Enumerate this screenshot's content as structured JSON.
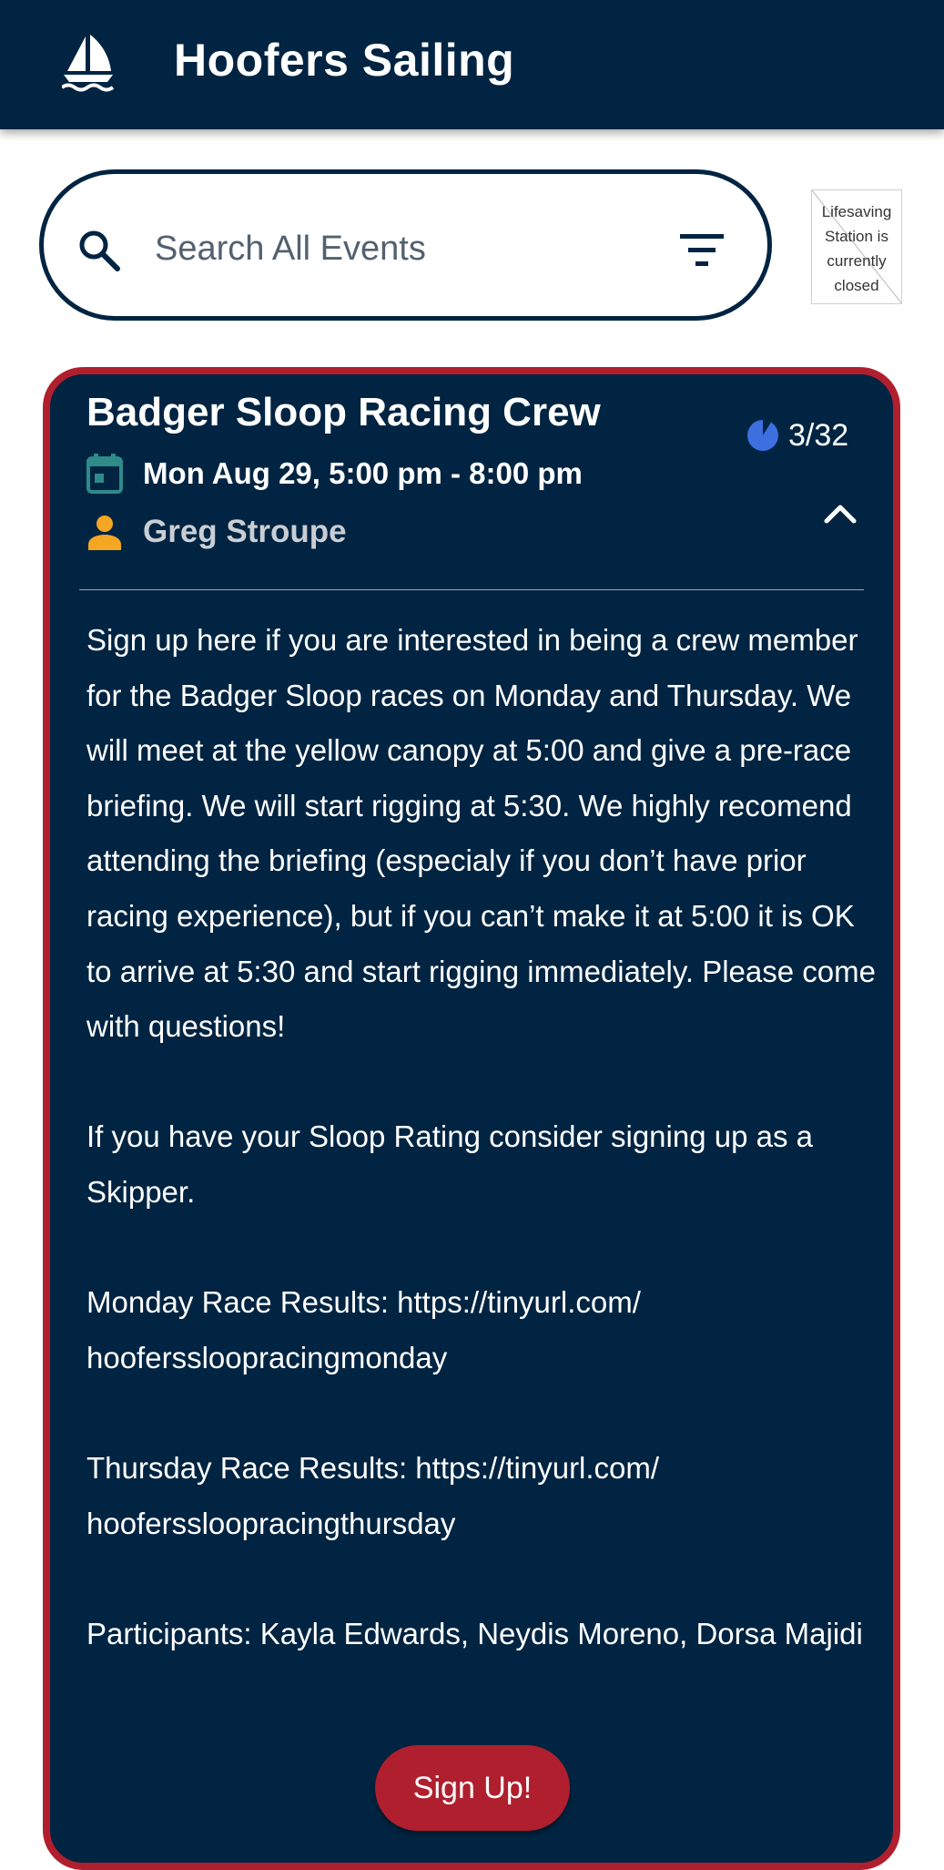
{
  "app": {
    "title": "Hoofers Sailing",
    "logo_icon": "sailboat-icon"
  },
  "search": {
    "placeholder": "Search All Events",
    "search_icon": "search-icon",
    "filter_icon": "filter-icon"
  },
  "lifesaving": {
    "text": "Lifesaving Station is currently closed"
  },
  "event": {
    "title": "Badger Sloop Racing Crew",
    "capacity": "3/32",
    "capacity_fraction": 0.09375,
    "datetime": "Mon Aug 29, 5:00 pm -  8:00 pm",
    "leader": "Greg Stroupe",
    "description": [
      "Sign up here if you are interested in being a crew member for the Badger Sloop races on Monday and Thursday. We will meet at the yellow canopy at 5:00 and give a pre-race briefing. We will start rigging at 5:30. We highly recomend attending the briefing (especialy if you don’t have prior racing experience), but if you can’t make it at 5:00 it is OK to arrive at 5:30 and start rigging immediately. Please come with questions!",
      "",
      "If you have your Sloop Rating consider signing up as a Skipper.",
      "",
      "Monday Race Results: https://tinyurl.com/\nhooferssloopracingmonday",
      "",
      "Thursday Race Results: https://tinyurl.com/\nhooferssloopracingthursday",
      "",
      "Participants: Kayla Edwards, Neydis Moreno, Dorsa Majidi"
    ],
    "signup_label": "Sign Up!"
  },
  "colors": {
    "navy": "#002442",
    "accent_red": "#b01f2e",
    "calendar_teal": "#2f8a8a",
    "person_orange": "#f5a623",
    "capacity_blue": "#3c6fe0"
  }
}
